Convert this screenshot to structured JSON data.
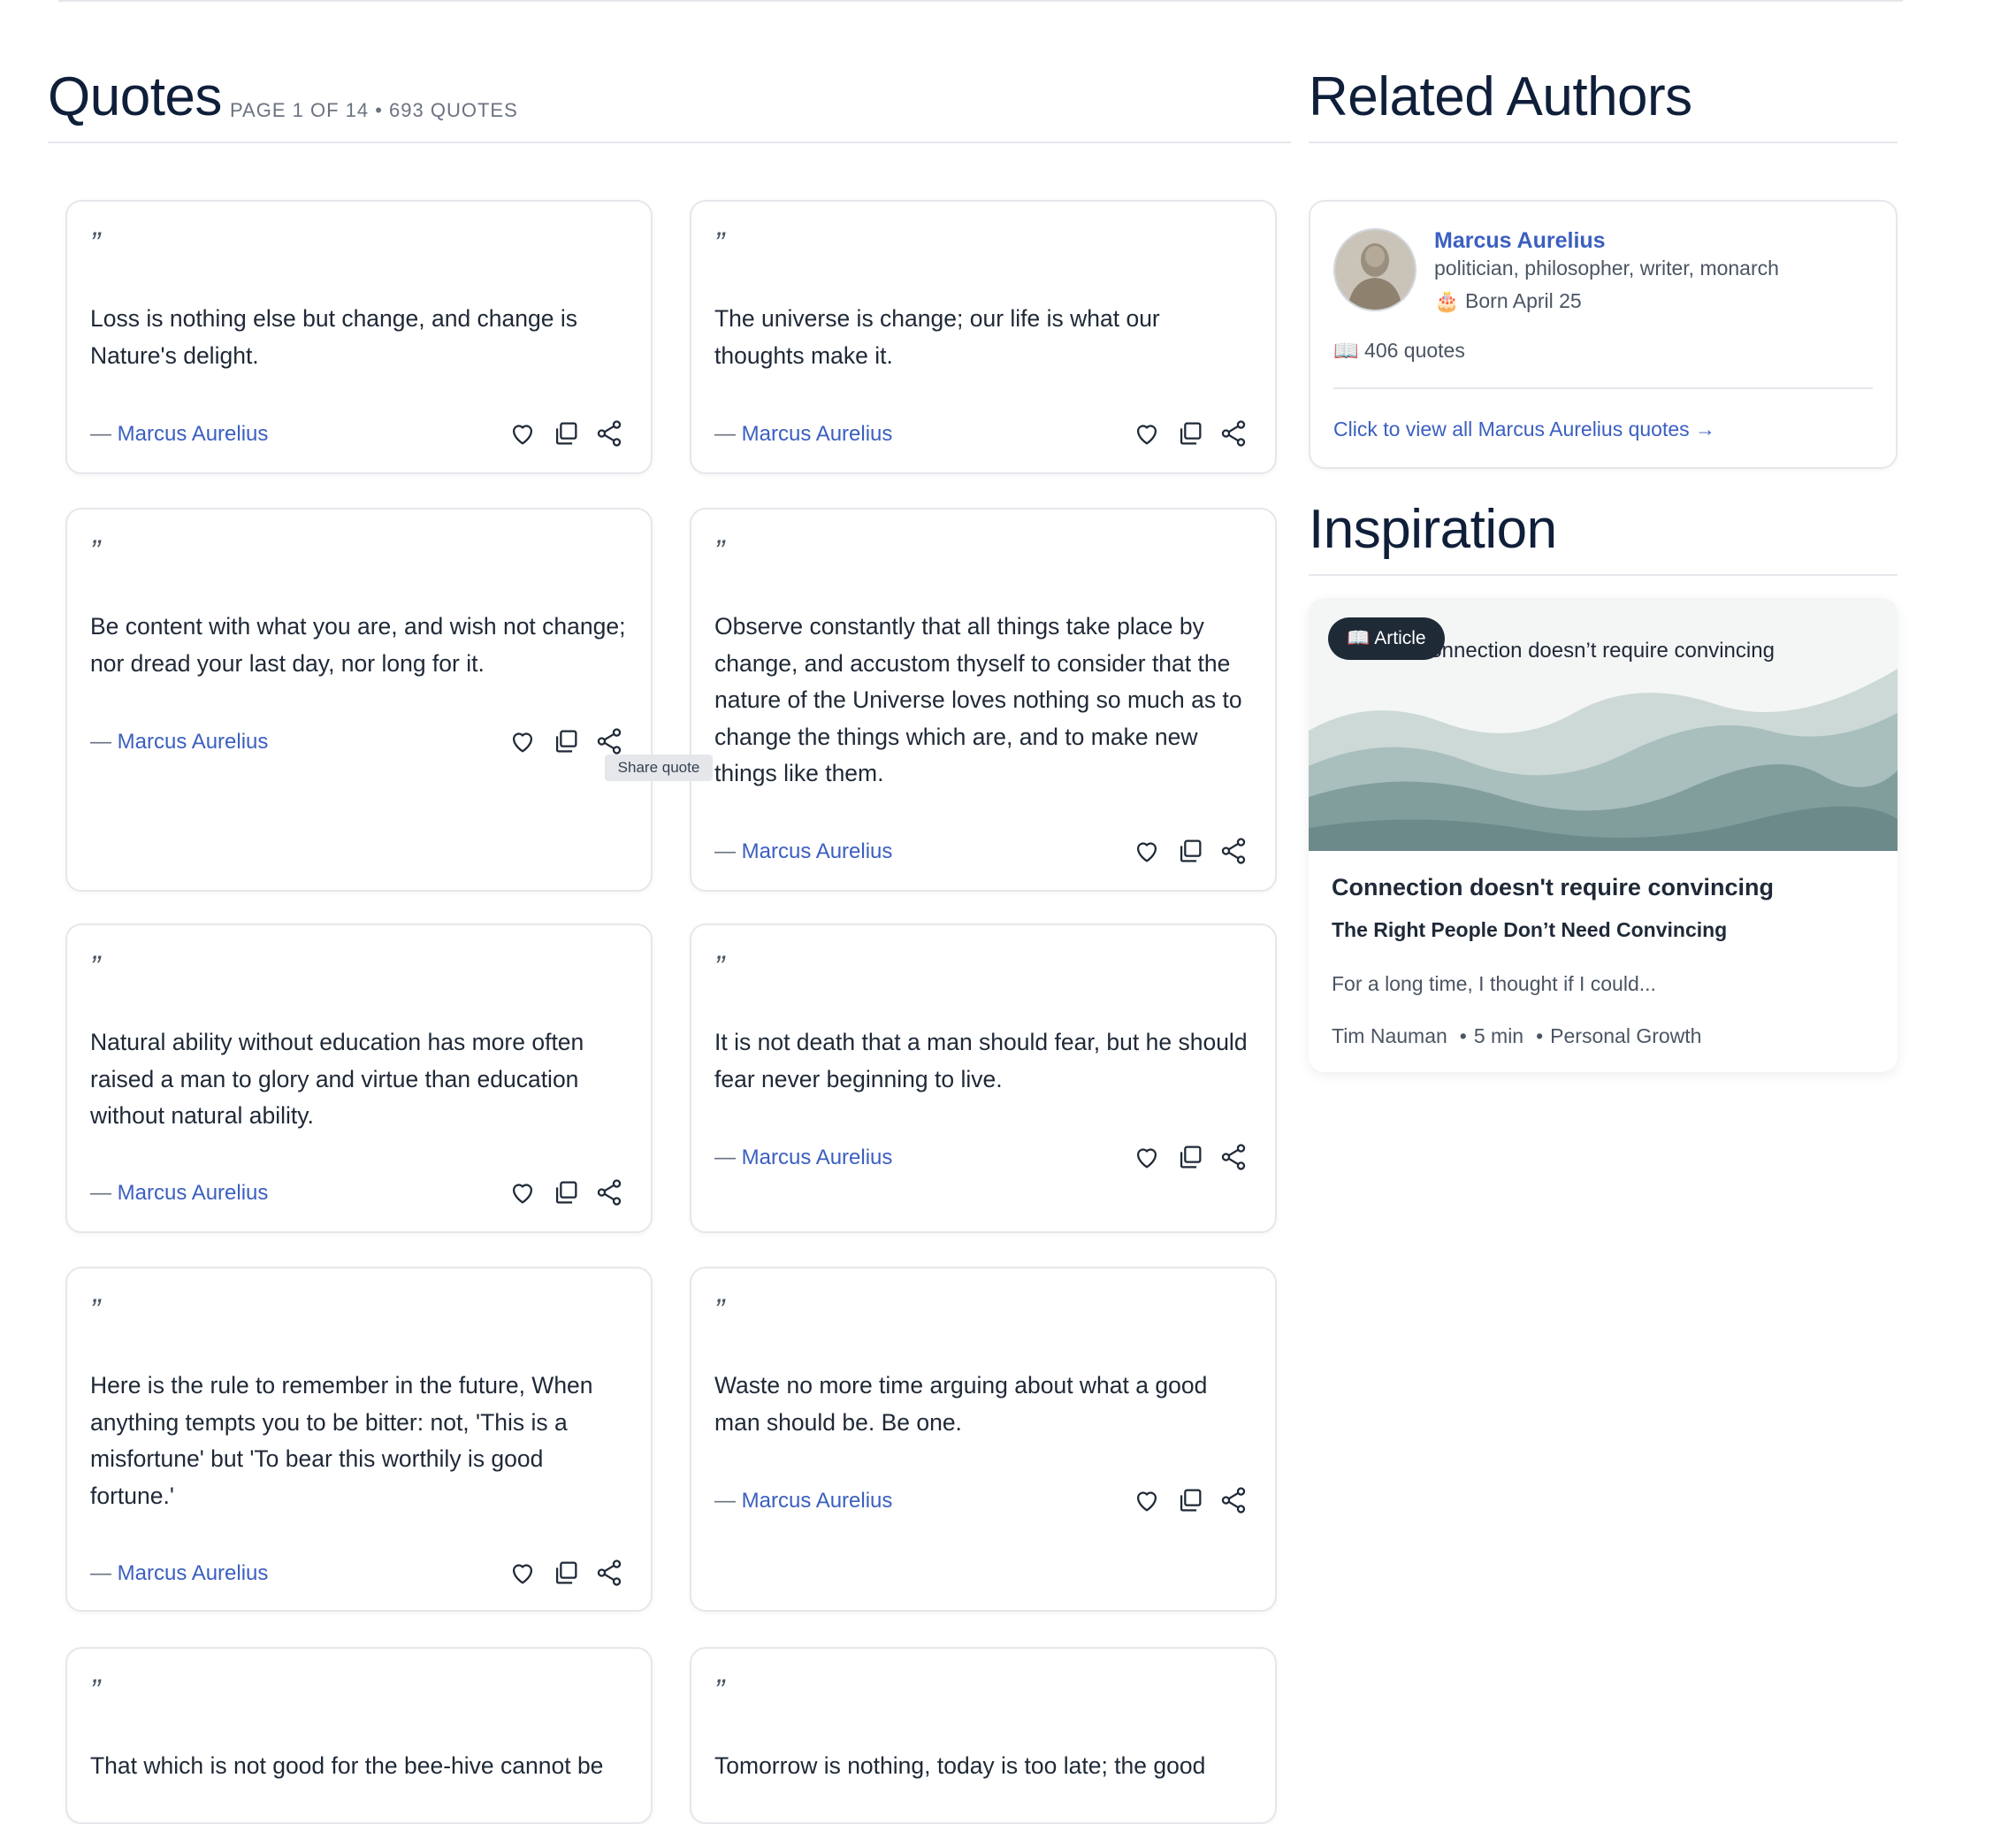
{
  "quotes_section": {
    "title": "Quotes",
    "meta": "PAGE 1 OF 14 • 693 QUOTES"
  },
  "quote_mark": "”",
  "quotes": [
    {
      "text": "Loss is nothing else but change, and change is Nature's delight.",
      "author": "Marcus Aurelius"
    },
    {
      "text": "The universe is change; our life is what our thoughts make it.",
      "author": "Marcus Aurelius"
    },
    {
      "text": "Be content with what you are, and wish not change; nor dread your last day, nor long for it.",
      "author": "Marcus Aurelius"
    },
    {
      "text": "Observe constantly that all things take place by change, and accustom thyself to consider that the nature of the Universe loves nothing so much as to change the things which are, and to make new things like them.",
      "author": "Marcus Aurelius"
    },
    {
      "text": "Natural ability without education has more often raised a man to glory and virtue than education without natural ability.",
      "author": "Marcus Aurelius"
    },
    {
      "text": "It is not death that a man should fear, but he should fear never beginning to live.",
      "author": "Marcus Aurelius"
    },
    {
      "text": "Here is the rule to remember in the future, When anything tempts you to be bitter: not, 'This is a misfortune' but 'To bear this worthily is good fortune.'",
      "author": "Marcus Aurelius"
    },
    {
      "text": "Waste no more time arguing about what a good man should be. Be one.",
      "author": "Marcus Aurelius"
    },
    {
      "text": "That which is not good for the bee-hive cannot be",
      "author": "Marcus Aurelius"
    },
    {
      "text": "Tomorrow is nothing, today is too late; the good",
      "author": "Marcus Aurelius"
    }
  ],
  "author_dash": "— ",
  "tooltip": "Share quote",
  "related_section": {
    "title": "Related Authors"
  },
  "related_author": {
    "name": "Marcus Aurelius",
    "description": "politician, philosopher, writer, monarch",
    "born": "🎂 Born April 25",
    "quote_count": "📖 406 quotes",
    "view_all": "Click to view all Marcus Aurelius quotes →"
  },
  "inspiration_section": {
    "title": "Inspiration"
  },
  "article": {
    "badge": "📖 Article",
    "overlay_text": "Connection doesn’t require convincing",
    "title": "Connection doesn't require convincing",
    "subtitle": "The Right People Don’t Need Convincing",
    "excerpt": "For a long time, I thought if I could...",
    "author": "Tim Nauman",
    "read_time": "5 min",
    "category": "Personal Growth",
    "dot": "•"
  },
  "colors": {
    "link": "#3b5fc0",
    "heading": "#0f1f3a",
    "border": "#e5e7eb",
    "badge_bg": "#1f2a37"
  },
  "icons": [
    "heart-icon",
    "copy-icon",
    "share-icon"
  ]
}
